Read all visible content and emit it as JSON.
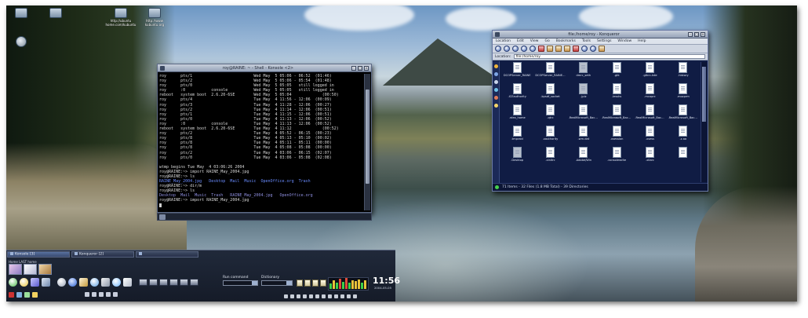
{
  "desktop": {
    "icons": [
      {
        "label": ""
      },
      {
        "label": ""
      },
      {
        "label": "http://ubuntu\nhome.com/kubuntu"
      },
      {
        "label": "http://www\nkubuntu.org"
      },
      {
        "label": ""
      }
    ]
  },
  "konsole": {
    "title": "roy@RAINE: ~ - Shell - Konsole <2>",
    "lines": [
      {
        "text": "roy      pts/1                          Wed May  5 05:06 - 06:52  (01:46)",
        "style": ""
      },
      {
        "text": "roy      pts/2                          Wed May  5 05:06 - 05:54  (01:48)",
        "style": ""
      },
      {
        "text": "roy      pts/0                          Wed May  5 05:05   still logged in",
        "style": ""
      },
      {
        "text": "roy      :0           console           Wed May  5 05:05   still logged in",
        "style": ""
      },
      {
        "text": "reboot   system boot  2.6.20-6SE        Wed May  5 05:04             (00:50)",
        "style": ""
      },
      {
        "text": "roy      pts/4                          Tue May  4 11:56 - 12:06  (00:09)",
        "style": ""
      },
      {
        "text": "roy      pts/3                          Tue May  4 11:28 - 12:06  (00:27)",
        "style": ""
      },
      {
        "text": "roy      pts/2                          Tue May  4 11:14 - 12:06  (00:51)",
        "style": ""
      },
      {
        "text": "roy      pts/1                          Tue May  4 11:15 - 12:06  (00:51)",
        "style": ""
      },
      {
        "text": "roy      pts/0                          Tue May  4 11:13 - 12:06  (00:52)",
        "style": ""
      },
      {
        "text": "roy      :0           console           Tue May  4 11:13 - 12:06  (00:52)",
        "style": ""
      },
      {
        "text": "reboot   system boot  2.6.20-6SE        Tue May  4 11:12             (00:52)",
        "style": ""
      },
      {
        "text": "roy      pts/2                          Tue May  4 05:52 - 06:15  (00:23)",
        "style": ""
      },
      {
        "text": "roy      pts/8                          Tue May  4 05:13 - 05:10  (00:02)",
        "style": ""
      },
      {
        "text": "roy      pts/8                          Tue May  4 05:11 - 05:11  (00:00)",
        "style": ""
      },
      {
        "text": "roy      pts/8                          Tue May  4 05:08 - 05:08  (00:00)",
        "style": ""
      },
      {
        "text": "roy      pts/2                          Tue May  4 03:06 - 06:15  (02:07)",
        "style": ""
      },
      {
        "text": "roy      pts/0                          Tue May  4 03:06 - 05:08  (02:08)",
        "style": ""
      },
      {
        "text": "",
        "style": ""
      },
      {
        "text": "wtmp begins Tue May  4 03:06:26 2004",
        "style": ""
      },
      {
        "text": "roy@RAINE:~> import RAINE_May_2004.jpg",
        "style": ""
      },
      {
        "text": "roy@RAINE:~> ls",
        "style": ""
      },
      {
        "text": "RAINE_May_2004.jpg   Desktop  Mail  Music  OpenOffice.org  Trash",
        "style": "hl-blue"
      },
      {
        "text": "roy@RAINE:~> dir/m",
        "style": ""
      },
      {
        "text": "roy@RAINE:~> ls",
        "style": ""
      },
      {
        "text": "Desktop  Mail  Music  Trash   RAINE_May_2004.jpg   OpenOffice.org",
        "style": "hl-dim"
      },
      {
        "text": "roy@RAINE:~> import RAINE_May_2004.jpg",
        "style": ""
      }
    ]
  },
  "konqueror": {
    "title": "file:/home/roy - Konqueror",
    "menu": [
      "Location",
      "Edit",
      "View",
      "Go",
      "Bookmarks",
      "Tools",
      "Settings",
      "Window",
      "Help"
    ],
    "location_label": "Location:",
    "location_value": "file:/home/roy",
    "files": [
      {
        "name": "DCOPServer_RAINE",
        "dark": false
      },
      {
        "name": "DCOPServer_RAINE_0",
        "dark": false
      },
      {
        "name": "dmrc_seth",
        "dark": true
      },
      {
        "name": ".gtk",
        "dark": false
      },
      {
        "name": ".gtkrc-kde",
        "dark": false
      },
      {
        "name": ".history",
        "dark": false
      },
      {
        "name": ".ICEauthority",
        "dark": false
      },
      {
        "name": ".kpsdf_socket",
        "dark": false
      },
      {
        "name": ".jpiz",
        "dark": true
      },
      {
        "name": ".lesshs",
        "dark": false
      },
      {
        "name": ".mcoprc",
        "dark": false
      },
      {
        "name": ".mozprm",
        "dark": false
      },
      {
        "name": ".rdex_home",
        "dark": false
      },
      {
        "name": ".qtrc",
        "dark": false
      },
      {
        "name": ".RealMicrosoft_BackUpSIM_NR",
        "dark": false
      },
      {
        "name": ".RealMicrosoft_BackUpSiccorl_NR",
        "dark": false
      },
      {
        "name": ".RealMicrosoft_BackPlayer_NR",
        "dark": false
      },
      {
        "name": ".RealMicrosoft_BackPlayer_NR_nr",
        "dark": false
      },
      {
        "name": ".tmpraid",
        "dark": false
      },
      {
        "name": ".xauthority",
        "dark": false
      },
      {
        "name": ".wm.dat",
        "dark": false
      },
      {
        "name": ".xsession",
        "dark": false
      },
      {
        "name": ".xsess",
        "dark": false
      },
      {
        "name": ".z.aa",
        "dark": false
      },
      {
        "name": ".Desktop",
        "dark": true
      },
      {
        "name": ".xinitrc",
        "dark": false
      },
      {
        "name": ".Adobe/Win",
        "dark": false
      },
      {
        "name": ".consolewrite",
        "dark": false
      },
      {
        "name": ".xllarc",
        "dark": false
      },
      {
        "name": "",
        "dark": false
      }
    ],
    "status": "71 Items - 32 Files (1.8 MB Total) - 39 Directories"
  },
  "panel": {
    "tasks": [
      {
        "label": "Konsole [3]",
        "active": true
      },
      {
        "label": "Konqueror [2]",
        "active": false
      },
      {
        "label": "",
        "active": false
      }
    ],
    "pager_labels": "Home  LAST  home",
    "run_label": "Run command",
    "dict_label": "Dictionary",
    "clock_time": "11:56",
    "clock_date": "2004-05-05",
    "meter_levels": [
      0.45,
      0.7,
      0.55,
      0.85,
      0.6,
      0.9,
      0.5,
      0.75,
      0.65,
      0.8,
      0.55,
      0.7
    ]
  }
}
